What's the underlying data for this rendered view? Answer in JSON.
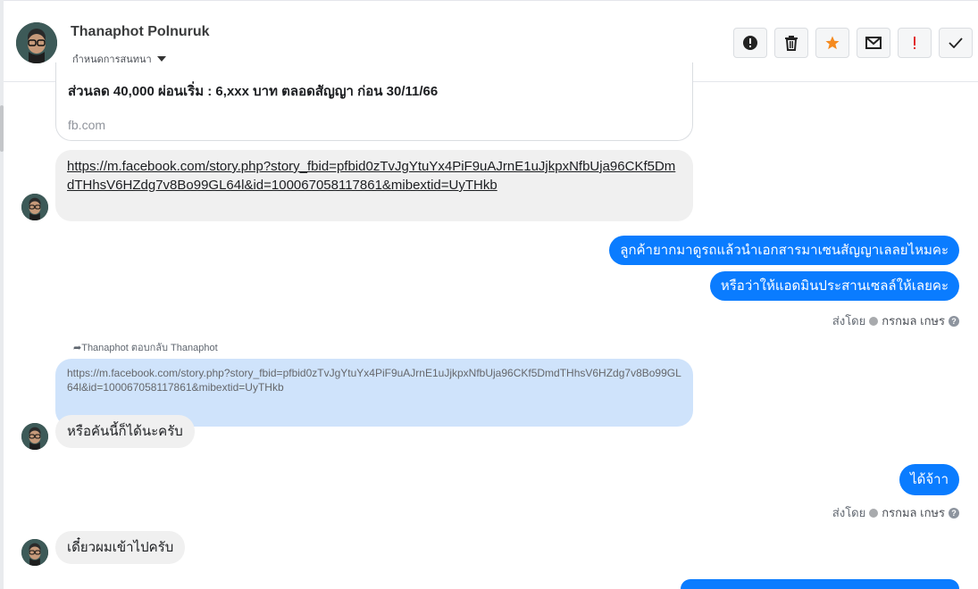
{
  "contact": {
    "name": "Thanaphot Polnuruk",
    "conversation_status": "กำหนดการสนทนา"
  },
  "toolbar": {
    "buttons": [
      {
        "name": "alert-icon",
        "label": "Mark as spam"
      },
      {
        "name": "trash-icon",
        "label": "Delete"
      },
      {
        "name": "star-icon",
        "label": "Star"
      },
      {
        "name": "mail-icon",
        "label": "Mark as unread"
      },
      {
        "name": "exclamation-icon",
        "label": "Important"
      },
      {
        "name": "check-icon",
        "label": "Done"
      }
    ],
    "accent_star": "#f58a1f",
    "accent_exclaim": "#e02a2a"
  },
  "messages": {
    "preview": {
      "title": "ส่วนลด 40,000 ผ่อนเริ่ม : 6,xxx บาท ตลอดสัญญา ก่อน 30/11/66",
      "domain": "fb.com"
    },
    "link": "https://m.facebook.com/story.php?story_fbid=pfbid0zTvJgYtuYx4PiF9uAJrnE1uJjkpxNfbUja96CKf5DmdTHhsV6HZdg7v8Bo99GL64l&id=100067058117861&mibextid=UyTHkb",
    "out1": "ลูกค้ายากมาดูรถแล้วนำเอกสารมาเซนสัญญาเลลยไหมคะ",
    "out2": "หรือว่าให้แอดมินประสานเซลล์ให้เลยคะ",
    "sent_by_label": "ส่งโดย",
    "sent_by_name": "กรกมล เกษร",
    "reply_meta": "Thanaphot ตอบกลับ Thanaphot",
    "reply_quote": "https://m.facebook.com/story.php?story_fbid=pfbid0zTvJgYtuYx4PiF9uAJrnE1uJjkpxNfbUja96CKf5DmdTHhsV6HZdg7v8Bo99GL64l&id=100067058117861&mibextid=UyTHkb",
    "in2": "หรือคันนี้ก็ได้นะครับ",
    "out3": "ได้จ้าา",
    "in3": "เดี๋ยวผมเข้าไปครับ"
  },
  "colors": {
    "outgoing_bubble": "#0a7cff",
    "incoming_bubble": "#f0f0f0",
    "reply_quote": "#cfe3fb"
  }
}
